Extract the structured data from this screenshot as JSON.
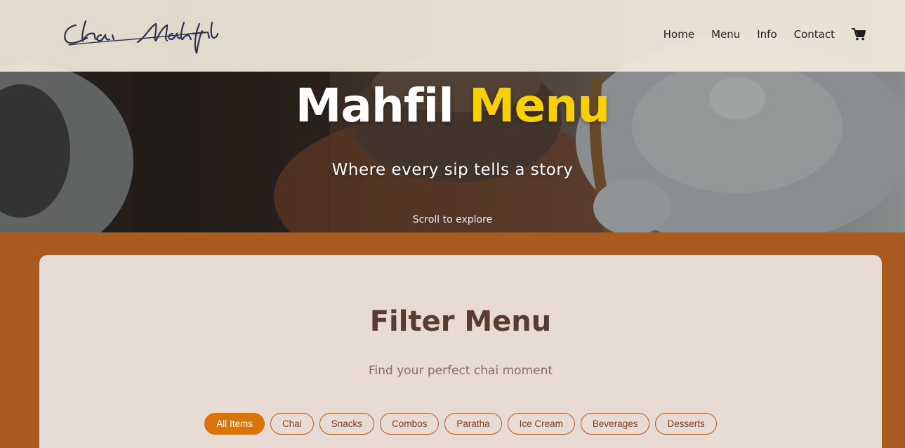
{
  "brand": {
    "logo_text": "Chai Mahfil"
  },
  "nav": {
    "items": [
      "Home",
      "Menu",
      "Info",
      "Contact"
    ],
    "cart_icon": "shopping-cart-icon"
  },
  "hero": {
    "title_main": "Mahfil",
    "title_accent": "Menu",
    "subtitle": "Where every sip tells a story",
    "scroll_hint": "Scroll to explore"
  },
  "filter": {
    "title": "Filter Menu",
    "subtitle": "Find your perfect chai moment",
    "chips": [
      "All Items",
      "Chai",
      "Snacks",
      "Combos",
      "Paratha",
      "Ice Cream",
      "Beverages",
      "Desserts"
    ],
    "active_chip": "All Items"
  },
  "colors": {
    "accent_yellow": "#f7d106",
    "section_bg": "#a95b1f",
    "card_bg": "#e8dbd4",
    "chip_active": "#d9730c",
    "heading_brown": "#5a3b30"
  }
}
